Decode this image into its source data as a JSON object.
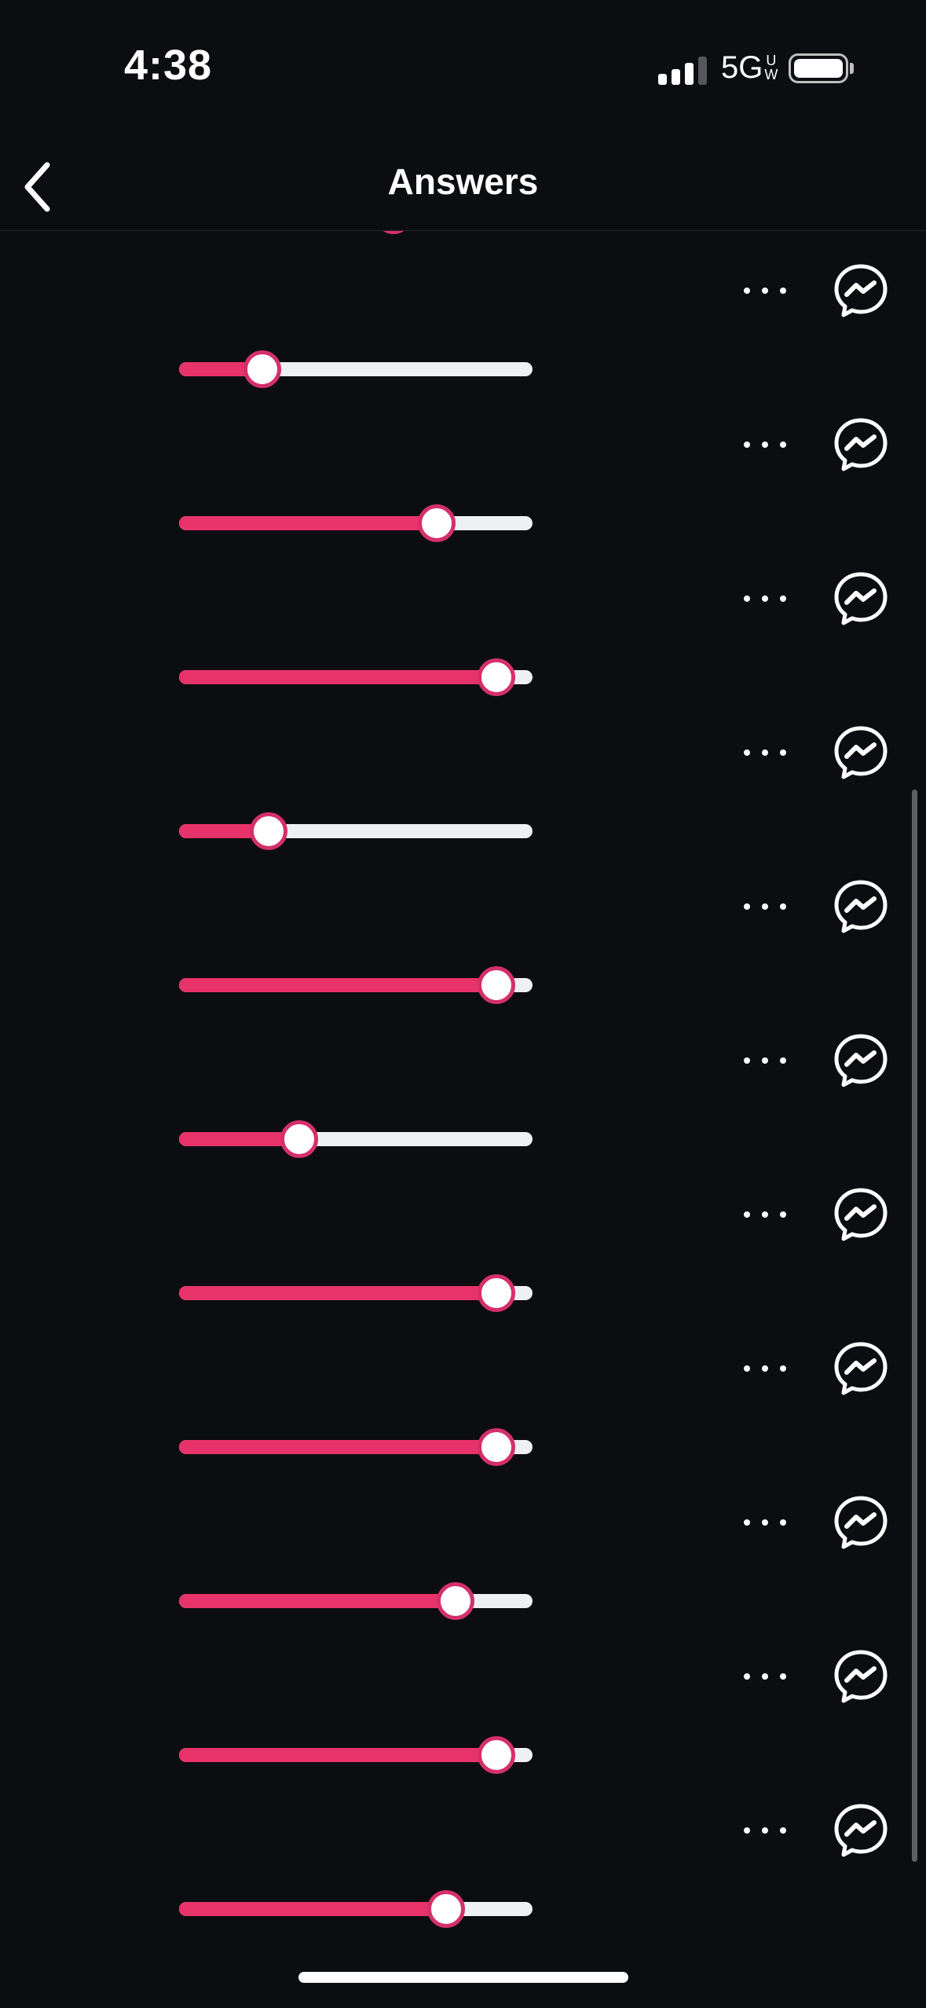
{
  "status_bar": {
    "time": "4:38",
    "network": "5G",
    "network_badge_top": "U",
    "network_badge_bottom": "W",
    "signal_bars": 4,
    "signal_bars_active": 3,
    "battery_level": 1.0
  },
  "header": {
    "title": "Answers",
    "back_icon": "chevron-left-icon"
  },
  "colors": {
    "background": "#0c0d10",
    "accent": "#e8336a",
    "track": "#eef0f3",
    "thumb_border": "#d4306a"
  },
  "answers": [
    {
      "value": 0.62
    },
    {
      "value": 0.2
    },
    {
      "value": 0.76
    },
    {
      "value": 0.95
    },
    {
      "value": 0.22
    },
    {
      "value": 0.95
    },
    {
      "value": 0.32
    },
    {
      "value": 0.95
    },
    {
      "value": 0.95
    },
    {
      "value": 0.82
    },
    {
      "value": 0.95
    },
    {
      "value": 0.79
    }
  ],
  "row_icons": {
    "more": "more-horizontal-icon",
    "share": "messenger-icon"
  }
}
